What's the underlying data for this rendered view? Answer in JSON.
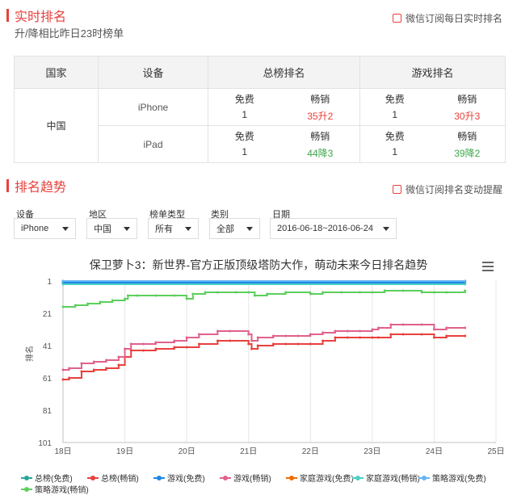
{
  "realtime": {
    "title": "实时排名",
    "subtitle": "升/降相比昨日23时榜单",
    "subscribe_label": "微信订阅每日实时排名"
  },
  "rank_table": {
    "headers": [
      "国家",
      "设备",
      "总榜排名",
      "游戏排名"
    ],
    "country": "中国",
    "rows": [
      {
        "device": "iPhone",
        "total": {
          "free_label": "免费",
          "free_value": "1",
          "paid_label": "畅销",
          "paid_value": "35升2"
        },
        "game": {
          "free_label": "免费",
          "free_value": "1",
          "paid_label": "畅销",
          "paid_value": "30升3"
        }
      },
      {
        "device": "iPad",
        "total": {
          "free_label": "免费",
          "free_value": "1",
          "paid_label": "畅销",
          "paid_value": "44降3"
        },
        "game": {
          "free_label": "免费",
          "free_value": "1",
          "paid_label": "畅销",
          "paid_value": "39降2"
        }
      }
    ]
  },
  "trend": {
    "title": "排名趋势",
    "subscribe_label": "微信订阅排名变动提醒"
  },
  "filters": {
    "device": {
      "label": "设备",
      "value": "iPhone"
    },
    "region": {
      "label": "地区",
      "value": "中国"
    },
    "list_type": {
      "label": "榜单类型",
      "value": "所有"
    },
    "category": {
      "label": "类别",
      "value": "全部"
    },
    "date": {
      "label": "日期",
      "value": "2016-06-18~2016-06-24"
    }
  },
  "colors": {
    "accent": "#e8413d",
    "up": "#e8413d",
    "down": "#3fa64a"
  },
  "chart_data": {
    "type": "line",
    "title": "保卫萝卜3：新世界-官方正版顶级塔防大作，萌动未来今日排名趋势",
    "ylabel": "排名",
    "xlabel": "",
    "y_reversed": true,
    "ylim": [
      1,
      101
    ],
    "yticks": [
      1,
      21,
      41,
      61,
      81,
      101
    ],
    "xticks": [
      "18日",
      "19日",
      "20日",
      "21日",
      "22日",
      "23日",
      "24日",
      "25日"
    ],
    "xlim": [
      0,
      7
    ],
    "grid": "vertical",
    "legend_position": "bottom",
    "series": [
      {
        "name": "总榜(免费)",
        "color": "#26a69a",
        "x": [
          0,
          6.5
        ],
        "y": [
          1,
          1
        ]
      },
      {
        "name": "总榜(畅销)",
        "color": "#e8413d",
        "x": [
          0,
          0.1,
          0.3,
          0.5,
          0.7,
          0.9,
          1.0,
          1.1,
          1.3,
          1.5,
          1.8,
          2.0,
          2.2,
          2.5,
          2.7,
          3.0,
          3.05,
          3.15,
          3.4,
          3.6,
          3.8,
          4.0,
          4.2,
          4.4,
          4.6,
          4.8,
          5.0,
          5.1,
          5.3,
          5.5,
          5.8,
          6.0,
          6.2,
          6.5
        ],
        "y": [
          62,
          61,
          57,
          56,
          55,
          53,
          48,
          44,
          44,
          43,
          42,
          42,
          40,
          38,
          38,
          40,
          43,
          41,
          40,
          40,
          40,
          40,
          38,
          36,
          36,
          36,
          36,
          36,
          34,
          34,
          34,
          36,
          35,
          35
        ]
      },
      {
        "name": "游戏(免费)",
        "color": "#1e88e5",
        "x": [
          0,
          6.5
        ],
        "y": [
          2,
          2
        ]
      },
      {
        "name": "游戏(畅销)",
        "color": "#e0628a",
        "x": [
          0,
          0.1,
          0.3,
          0.5,
          0.7,
          0.9,
          1.0,
          1.1,
          1.3,
          1.5,
          1.8,
          2.0,
          2.2,
          2.5,
          2.7,
          3.0,
          3.05,
          3.15,
          3.4,
          3.6,
          3.8,
          4.0,
          4.2,
          4.4,
          4.6,
          4.8,
          5.0,
          5.1,
          5.3,
          5.5,
          5.8,
          6.0,
          6.2,
          6.5
        ],
        "y": [
          56,
          55,
          52,
          51,
          50,
          48,
          43,
          40,
          40,
          39,
          38,
          36,
          34,
          32,
          32,
          34,
          38,
          36,
          35,
          35,
          35,
          34,
          33,
          32,
          32,
          32,
          31,
          30,
          28,
          28,
          28,
          31,
          30,
          30
        ]
      },
      {
        "name": "家庭游戏(免费)",
        "color": "#ef6c00",
        "x": [
          0,
          6.5
        ],
        "y": [
          1,
          1
        ]
      },
      {
        "name": "家庭游戏(畅销)",
        "color": "#4dd0c4",
        "x": [
          0,
          6.5
        ],
        "y": [
          3,
          3
        ]
      },
      {
        "name": "策略游戏(免费)",
        "color": "#64b5f6",
        "x": [
          0,
          6.5
        ],
        "y": [
          1,
          1
        ]
      },
      {
        "name": "策略游戏(畅销)",
        "color": "#5ccf5c",
        "x": [
          0,
          0.2,
          0.4,
          0.6,
          0.8,
          1.0,
          1.05,
          1.2,
          1.5,
          1.8,
          2.0,
          2.1,
          2.3,
          2.5,
          2.8,
          3.0,
          3.1,
          3.3,
          3.6,
          4.0,
          4.2,
          4.5,
          4.8,
          5.0,
          5.2,
          5.5,
          5.8,
          6.0,
          6.2,
          6.5
        ],
        "y": [
          17,
          16,
          15,
          14,
          13,
          12,
          10,
          10,
          10,
          10,
          12,
          9,
          8,
          8,
          8,
          8,
          10,
          9,
          8,
          9,
          8,
          8,
          8,
          8,
          7,
          7,
          8,
          8,
          8,
          7
        ]
      }
    ]
  }
}
